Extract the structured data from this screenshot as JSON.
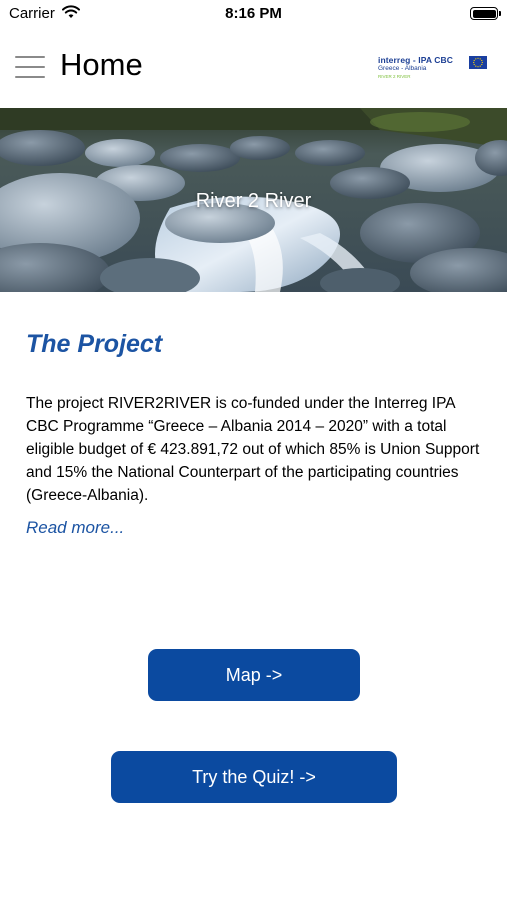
{
  "status_bar": {
    "carrier": "Carrier",
    "time": "8:16 PM",
    "battery": 1.0
  },
  "header": {
    "title": "Home",
    "logo": {
      "line1": "interreg - IPA CBC",
      "line2": "Greece - Albania",
      "tagline": "RIVER 2 RIVER"
    }
  },
  "hero": {
    "title": "River 2 River"
  },
  "project": {
    "title": "The Project",
    "body": "The project RIVER2RIVER is co-funded under the Interreg IPA CBC Programme “Greece – Albania 2014 – 2020” with a total eligible budget of € 423.891,72 out of which 85% is Union Support and 15% the National Counterpart of the participating countries (Greece-Albania).",
    "read_more": "Read more..."
  },
  "buttons": {
    "map": "Map ->",
    "quiz": "Try the Quiz! ->"
  },
  "colors": {
    "accent": "#1c54a3",
    "button_bg": "#0b4aa0",
    "logo_blue": "#1c3f94",
    "logo_green": "#7cbf3a"
  },
  "icons": [
    "wifi-icon",
    "battery-icon",
    "menu-icon",
    "eu-flag-icon"
  ]
}
